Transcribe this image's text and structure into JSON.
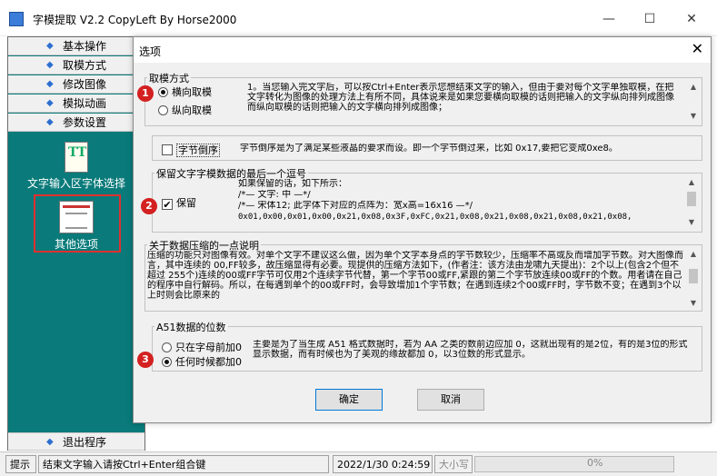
{
  "app": {
    "title": "字模提取 V2.2  CopyLeft By Horse2000",
    "minimize": "—",
    "maximize": "☐",
    "close": "✕"
  },
  "sidebar": {
    "items": [
      {
        "label": "基本操作"
      },
      {
        "label": "取模方式"
      },
      {
        "label": "修改图像"
      },
      {
        "label": "模拟动画"
      },
      {
        "label": "参数设置"
      }
    ],
    "tools": [
      {
        "label": "文字输入区字体选择",
        "icon": "tt-font-icon",
        "icon_text": "TT"
      },
      {
        "label": "其他选项",
        "icon": "options-document-icon"
      }
    ],
    "exit_label": "退出程序"
  },
  "status": {
    "prefix": "提示",
    "message": "结束文字输入请按Ctrl+Enter组合键",
    "datetime": "2022/1/30 0:24:59",
    "caps": "大小写",
    "progress_percent": 0,
    "progress_text": "0%"
  },
  "dialog": {
    "title": "选项",
    "close": "✕",
    "mode": {
      "group_title": "取模方式",
      "options": [
        {
          "label": "横向取模",
          "selected": true
        },
        {
          "label": "纵向取模",
          "selected": false
        }
      ],
      "description": "1。当您输入完文字后，可以按Ctrl+Enter表示您想结束文字的输入，但由于要对每个文字单独取模，在把文字转化为图像的处理方法上有所不同，具体说来是如果您要横向取模的话则把输入的文字纵向排列成图像而纵向取模的话则把输入的文字横向排列成图像；"
    },
    "byte_order": {
      "label": "字节倒序",
      "checked": false,
      "description": "字节倒序是为了满足某些液晶的要求而设。即一个字节倒过来，比如 0x17,要把它变成0xe8。"
    },
    "keep": {
      "group_title": "保留文字字模数据的最后一个逗号",
      "label": "保留",
      "checked": true,
      "lines": [
        "如果保留的话，如下所示：",
        "/*—   文字:   中   —*/",
        "/*—  宋体12;  此字体下对应的点阵为：宽x高=16x16   —*/",
        "0x01,0x00,0x01,0x00,0x21,0x08,0x3F,0xFC,0x21,0x08,0x21,0x08,0x21,0x08,0x21,0x08,"
      ]
    },
    "compression": {
      "group_title": "关于数据压缩的一点说明",
      "description": "压缩的功能只对图像有效。对单个文字不建议这么做，因为单个文字本身点的字节数较少，压缩率不高或反而增加字节数。对大图像而言，其中连续的 00,FF较多，故压缩显得有必要。现提供的压缩方法如下，(作者注：该方法由龙啸九天提出)：2个以上(包含2个但不超过 255个)连续的00或FF字节可仅用2个连续字节代替，第一个字节00或FF,紧跟的第二个字节放连续00或FF的个数。用者请在自己的程序中自行解码。所以，在每遇到单个的00或FF时，会导致增加1个字节数；在遇到连续2个00或FF时，字节数不变；在遇到3个以上时则会比原来的"
    },
    "a51": {
      "group_title": "A51数据的位数",
      "options": [
        {
          "label": "只在字母前加0",
          "selected": false
        },
        {
          "label": "任何时候都加0",
          "selected": true
        }
      ],
      "description": "主要是为了当生成 A51 格式数据时，若为 AA 之类的数前边应加 0，这就出现有的是2位，有的是3位的形式显示数据，而有时候也为了美观的缘故都加 0，以3位数的形式显示。"
    },
    "ok_label": "确定",
    "cancel_label": "取消"
  },
  "annotations": [
    "1",
    "2",
    "3"
  ],
  "colors": {
    "sidebar_bg": "#0a7a7a",
    "badge": "#d42020",
    "dialog_bg": "#f0f0f0"
  }
}
